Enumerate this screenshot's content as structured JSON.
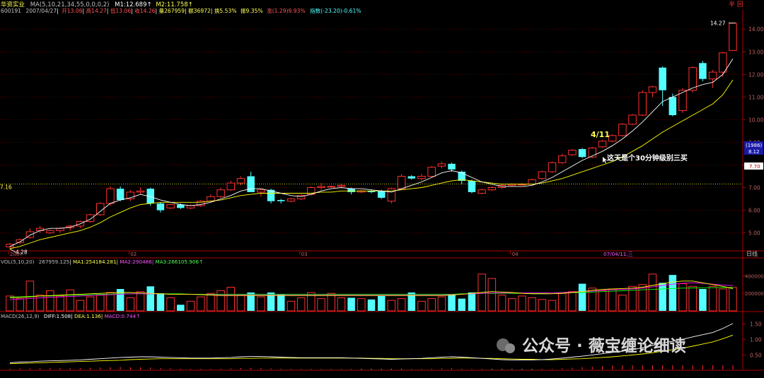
{
  "header": {
    "stock_name": "华资实业",
    "ma_params": "MA(5,10,21,34,55,0,0,0,2)",
    "m1": "M1:12.689",
    "m2": "M2:11.758",
    "line2": {
      "code": "600191",
      "date": "2007/04/27",
      "open": "开13.06",
      "high": "高14.27",
      "low": "低13.06",
      "close": "收14.26",
      "volume": "量267959",
      "amount": "额36972",
      "turnover": "换5.53%",
      "amplitude": "振9.35%",
      "change": "涨(1.29)9.93%",
      "index": "指数(-23.20)-0.61%"
    },
    "right_mark": "半 回"
  },
  "price_panel": {
    "ylim": [
      4.3,
      14.6
    ],
    "ticks": [
      "14.00",
      "13.00",
      "12.00",
      "11.00",
      "10.00",
      "9.00",
      "8.00",
      "7.00",
      "6.00",
      "5.00"
    ],
    "tick_values": [
      14,
      13,
      12,
      11,
      10,
      9,
      8,
      7,
      6,
      5
    ],
    "max_label": "14.27",
    "min_label": "4.28",
    "ref_line_value": 7.16,
    "ref_line_label": "7.16",
    "ref_right_label": "7.70",
    "side_box": {
      "line1": "(1986)",
      "line2": "8.12"
    },
    "date_labels": [
      "2007",
      "02",
      "03",
      "04"
    ],
    "cursor_date": "07/04/11,三",
    "unit_label": "日线",
    "annotation_date": "4/11",
    "annotation_text": "这天是个30分钟级别三买"
  },
  "volume_panel": {
    "label": "VOL(5,10,20)",
    "vol": "267959.125",
    "ma1": "MA1:254184.281",
    "ma2": "MA2:290486",
    "ma3": "MA3:266105.906",
    "ylim": [
      0,
      500000
    ],
    "ticks": [
      "400000",
      "200000"
    ],
    "tick_values": [
      400000,
      200000
    ]
  },
  "macd_panel": {
    "label": "MACD(26,12,9)",
    "diff": "DIFF:1.508",
    "dea": "DEA:1.136",
    "macd": "MACD:0.744",
    "ylim": [
      0.1,
      1.62
    ],
    "ticks": [
      "1.50",
      "1.00",
      "0.50"
    ],
    "tick_values": [
      1.5,
      1.0,
      0.5
    ]
  },
  "watermark": "公众号 · 薇宝缠论细读",
  "colors": {
    "up": "#ff3030",
    "down": "#54ffff",
    "ma_white": "#ffffff",
    "ma_yellow": "#ffff00",
    "ma_magenta": "#ff00ff",
    "ma_green": "#00ff00",
    "grid": "#8b0000",
    "yellow_text": "#ffff54"
  },
  "chart_data": {
    "type": "candlestick",
    "candles": [
      [
        4.38,
        4.55,
        4.28,
        4.5
      ],
      [
        4.58,
        4.75,
        4.5,
        4.7
      ],
      [
        4.8,
        5.2,
        4.75,
        5.05
      ],
      [
        5.1,
        5.3,
        5.0,
        5.2
      ],
      [
        5.0,
        5.15,
        4.95,
        5.1
      ],
      [
        5.1,
        5.25,
        5.0,
        5.2
      ],
      [
        5.22,
        5.35,
        5.1,
        5.3
      ],
      [
        5.3,
        5.55,
        5.2,
        5.5
      ],
      [
        5.5,
        5.85,
        5.45,
        5.8
      ],
      [
        5.8,
        6.35,
        5.75,
        6.3
      ],
      [
        6.3,
        7.05,
        6.2,
        6.95
      ],
      [
        6.95,
        7.05,
        6.4,
        6.45
      ],
      [
        6.5,
        6.9,
        6.4,
        6.8
      ],
      [
        6.8,
        7.0,
        6.7,
        6.85
      ],
      [
        6.95,
        7.0,
        6.2,
        6.3
      ],
      [
        6.3,
        6.35,
        5.9,
        6.0
      ],
      [
        6.1,
        6.3,
        6.05,
        6.25
      ],
      [
        6.25,
        6.3,
        6.05,
        6.1
      ],
      [
        6.1,
        6.25,
        6.05,
        6.2
      ],
      [
        6.2,
        6.45,
        6.15,
        6.4
      ],
      [
        6.4,
        6.7,
        6.35,
        6.6
      ],
      [
        6.6,
        7.0,
        6.55,
        6.9
      ],
      [
        6.9,
        7.3,
        6.85,
        7.2
      ],
      [
        7.2,
        7.5,
        7.1,
        7.4
      ],
      [
        7.5,
        7.7,
        6.9,
        6.8
      ],
      [
        6.8,
        6.95,
        6.6,
        6.9
      ],
      [
        6.9,
        6.95,
        6.3,
        6.4
      ],
      [
        6.45,
        6.5,
        6.3,
        6.4
      ],
      [
        6.4,
        6.55,
        6.35,
        6.5
      ],
      [
        6.5,
        6.7,
        6.45,
        6.65
      ],
      [
        6.7,
        7.05,
        6.65,
        7.0
      ],
      [
        7.0,
        7.2,
        6.9,
        7.05
      ],
      [
        7.05,
        7.1,
        7.0,
        7.05
      ],
      [
        7.05,
        7.15,
        7.0,
        7.1
      ],
      [
        6.95,
        7.0,
        6.7,
        6.8
      ],
      [
        6.8,
        6.9,
        6.75,
        6.85
      ],
      [
        6.85,
        6.9,
        6.75,
        6.8
      ],
      [
        6.85,
        6.9,
        6.5,
        6.55
      ],
      [
        6.4,
        7.0,
        6.3,
        6.95
      ],
      [
        6.95,
        7.6,
        6.9,
        7.5
      ],
      [
        7.5,
        7.55,
        7.35,
        7.4
      ],
      [
        7.4,
        7.6,
        7.3,
        7.5
      ],
      [
        7.5,
        7.95,
        7.45,
        7.9
      ],
      [
        7.95,
        8.15,
        7.85,
        8.05
      ],
      [
        8.05,
        8.1,
        7.7,
        7.8
      ],
      [
        7.7,
        7.75,
        7.15,
        7.3
      ],
      [
        7.3,
        7.35,
        6.75,
        6.8
      ],
      [
        6.75,
        6.95,
        6.7,
        6.9
      ],
      [
        6.9,
        7.05,
        6.85,
        7.0
      ],
      [
        7.0,
        7.15,
        6.95,
        7.1
      ],
      [
        7.1,
        7.2,
        7.05,
        7.15
      ],
      [
        7.15,
        7.2,
        7.1,
        7.15
      ],
      [
        7.15,
        7.4,
        7.1,
        7.35
      ],
      [
        7.4,
        7.75,
        7.35,
        7.7
      ],
      [
        7.7,
        8.15,
        7.65,
        8.1
      ],
      [
        8.1,
        8.5,
        8.05,
        8.4
      ],
      [
        8.45,
        8.7,
        8.4,
        8.65
      ],
      [
        8.7,
        8.75,
        8.3,
        8.35
      ],
      [
        8.35,
        8.8,
        8.3,
        8.75
      ],
      [
        8.8,
        9.1,
        8.75,
        9.05
      ],
      [
        9.05,
        9.35,
        9.0,
        9.3
      ],
      [
        9.3,
        9.85,
        9.25,
        9.8
      ],
      [
        9.8,
        10.25,
        9.75,
        10.2
      ],
      [
        10.2,
        11.3,
        10.15,
        11.2
      ],
      [
        11.2,
        11.5,
        11.0,
        11.45
      ],
      [
        12.3,
        12.35,
        10.6,
        11.3
      ],
      [
        11.0,
        11.15,
        10.15,
        10.2
      ],
      [
        10.4,
        11.4,
        10.3,
        11.3
      ],
      [
        11.3,
        12.35,
        11.2,
        12.3
      ],
      [
        12.5,
        12.6,
        11.7,
        11.8
      ],
      [
        11.8,
        12.2,
        11.4,
        12.1
      ],
      [
        12.1,
        13.0,
        11.9,
        12.95
      ],
      [
        13.06,
        14.27,
        13.06,
        14.26
      ]
    ],
    "ma_white": [
      4.4,
      4.6,
      4.9,
      5.1,
      5.2,
      5.2,
      5.25,
      5.4,
      5.6,
      5.95,
      6.3,
      6.45,
      6.55,
      6.7,
      6.6,
      6.45,
      6.35,
      6.25,
      6.2,
      6.25,
      6.35,
      6.5,
      6.65,
      6.85,
      6.95,
      6.95,
      6.85,
      6.75,
      6.65,
      6.6,
      6.7,
      6.85,
      6.95,
      7.0,
      6.95,
      6.95,
      6.9,
      6.85,
      6.8,
      6.95,
      7.1,
      7.25,
      7.45,
      7.65,
      7.75,
      7.65,
      7.45,
      7.25,
      7.15,
      7.05,
      7.05,
      7.05,
      7.1,
      7.25,
      7.45,
      7.7,
      7.95,
      8.2,
      8.4,
      8.6,
      8.85,
      9.15,
      9.5,
      9.9,
      10.35,
      10.8,
      11.0,
      11.2,
      11.4,
      11.55,
      11.65,
      12.0,
      12.69
    ],
    "ma_yellow": [
      4.3,
      4.4,
      4.55,
      4.7,
      4.8,
      4.9,
      5.0,
      5.1,
      5.25,
      5.45,
      5.7,
      5.9,
      6.1,
      6.25,
      6.3,
      6.35,
      6.35,
      6.35,
      6.35,
      6.35,
      6.4,
      6.45,
      6.55,
      6.65,
      6.7,
      6.75,
      6.75,
      6.75,
      6.75,
      6.75,
      6.75,
      6.8,
      6.8,
      6.85,
      6.85,
      6.85,
      6.85,
      6.85,
      6.85,
      6.9,
      6.95,
      7.0,
      7.1,
      7.2,
      7.3,
      7.35,
      7.3,
      7.25,
      7.2,
      7.15,
      7.15,
      7.15,
      7.15,
      7.2,
      7.3,
      7.4,
      7.55,
      7.7,
      7.85,
      8.0,
      8.15,
      8.35,
      8.6,
      8.85,
      9.15,
      9.45,
      9.7,
      9.95,
      10.2,
      10.45,
      10.7,
      11.1,
      11.76
    ],
    "volumes": [
      170000,
      140000,
      340000,
      180000,
      230000,
      170000,
      240000,
      120000,
      160000,
      180000,
      210000,
      250000,
      150000,
      220000,
      280000,
      200000,
      150000,
      70000,
      110000,
      160000,
      200000,
      230000,
      270000,
      180000,
      210000,
      160000,
      210000,
      190000,
      110000,
      150000,
      210000,
      140000,
      200000,
      150000,
      150000,
      140000,
      130000,
      170000,
      120000,
      140000,
      210000,
      110000,
      140000,
      160000,
      190000,
      140000,
      210000,
      420000,
      370000,
      180000,
      140000,
      170000,
      150000,
      130000,
      120000,
      200000,
      220000,
      310000,
      260000,
      230000,
      250000,
      180000,
      280000,
      300000,
      420000,
      320000,
      410000,
      310000,
      280000,
      250000,
      280000,
      250000,
      267959
    ],
    "vol_ma1": [
      150000,
      155000,
      160000,
      170000,
      175000,
      180000,
      185000,
      190000,
      195000,
      200000,
      205000,
      210000,
      210000,
      205000,
      200000,
      195000,
      190000,
      190000,
      190000,
      185000,
      180000,
      175000,
      175000,
      175000,
      175000,
      175000,
      175000,
      175000,
      175000,
      175000,
      175000,
      175000,
      175000,
      175000,
      175000,
      175000,
      175000,
      175000,
      175000,
      175000,
      175000,
      175000,
      175000,
      175000,
      180000,
      190000,
      200000,
      210000,
      220000,
      215000,
      210000,
      200000,
      195000,
      195000,
      195000,
      200000,
      210000,
      220000,
      235000,
      245000,
      250000,
      255000,
      260000,
      270000,
      290000,
      310000,
      330000,
      340000,
      340000,
      320000,
      300000,
      280000,
      254184
    ],
    "vol_ma2": [
      130000,
      135000,
      140000,
      150000,
      155000,
      160000,
      165000,
      170000,
      175000,
      180000,
      185000,
      190000,
      195000,
      195000,
      195000,
      195000,
      190000,
      190000,
      190000,
      185000,
      185000,
      180000,
      180000,
      180000,
      180000,
      180000,
      180000,
      180000,
      180000,
      180000,
      180000,
      180000,
      180000,
      180000,
      180000,
      180000,
      180000,
      180000,
      180000,
      180000,
      180000,
      180000,
      180000,
      180000,
      185000,
      190000,
      195000,
      200000,
      205000,
      205000,
      205000,
      205000,
      205000,
      205000,
      205000,
      210000,
      215000,
      220000,
      225000,
      235000,
      240000,
      245000,
      250000,
      260000,
      275000,
      290000,
      305000,
      315000,
      320000,
      315000,
      305000,
      295000,
      290486
    ],
    "vol_ma3": [
      160000,
      160000,
      165000,
      170000,
      170000,
      175000,
      180000,
      180000,
      185000,
      190000,
      190000,
      195000,
      195000,
      195000,
      195000,
      195000,
      195000,
      195000,
      190000,
      190000,
      190000,
      190000,
      190000,
      190000,
      190000,
      190000,
      190000,
      190000,
      190000,
      190000,
      190000,
      190000,
      190000,
      190000,
      190000,
      190000,
      190000,
      190000,
      190000,
      190000,
      190000,
      190000,
      190000,
      190000,
      190000,
      195000,
      195000,
      200000,
      200000,
      200000,
      200000,
      200000,
      200000,
      200000,
      205000,
      205000,
      210000,
      210000,
      215000,
      220000,
      225000,
      230000,
      235000,
      240000,
      245000,
      250000,
      255000,
      260000,
      262000,
      264000,
      265000,
      266000,
      266105
    ],
    "diff": [
      0.25,
      0.27,
      0.28,
      0.3,
      0.31,
      0.32,
      0.33,
      0.34,
      0.36,
      0.38,
      0.4,
      0.42,
      0.43,
      0.44,
      0.44,
      0.43,
      0.42,
      0.41,
      0.4,
      0.4,
      0.4,
      0.41,
      0.42,
      0.44,
      0.45,
      0.45,
      0.44,
      0.43,
      0.42,
      0.41,
      0.41,
      0.41,
      0.41,
      0.41,
      0.4,
      0.39,
      0.38,
      0.37,
      0.36,
      0.37,
      0.38,
      0.39,
      0.41,
      0.43,
      0.44,
      0.43,
      0.41,
      0.39,
      0.37,
      0.35,
      0.34,
      0.34,
      0.34,
      0.35,
      0.37,
      0.4,
      0.43,
      0.46,
      0.5,
      0.54,
      0.58,
      0.62,
      0.67,
      0.73,
      0.8,
      0.88,
      0.94,
      1.0,
      1.08,
      1.15,
      1.22,
      1.35,
      1.508
    ],
    "dea": [
      0.22,
      0.23,
      0.24,
      0.25,
      0.26,
      0.27,
      0.28,
      0.29,
      0.3,
      0.31,
      0.32,
      0.33,
      0.35,
      0.36,
      0.37,
      0.38,
      0.38,
      0.38,
      0.38,
      0.38,
      0.38,
      0.38,
      0.38,
      0.39,
      0.39,
      0.4,
      0.4,
      0.4,
      0.4,
      0.4,
      0.4,
      0.4,
      0.4,
      0.4,
      0.4,
      0.4,
      0.39,
      0.39,
      0.38,
      0.38,
      0.38,
      0.38,
      0.38,
      0.39,
      0.39,
      0.4,
      0.4,
      0.39,
      0.39,
      0.38,
      0.37,
      0.36,
      0.36,
      0.35,
      0.35,
      0.36,
      0.37,
      0.38,
      0.4,
      0.42,
      0.44,
      0.47,
      0.5,
      0.53,
      0.57,
      0.62,
      0.67,
      0.72,
      0.78,
      0.85,
      0.92,
      1.02,
      1.136
    ]
  }
}
